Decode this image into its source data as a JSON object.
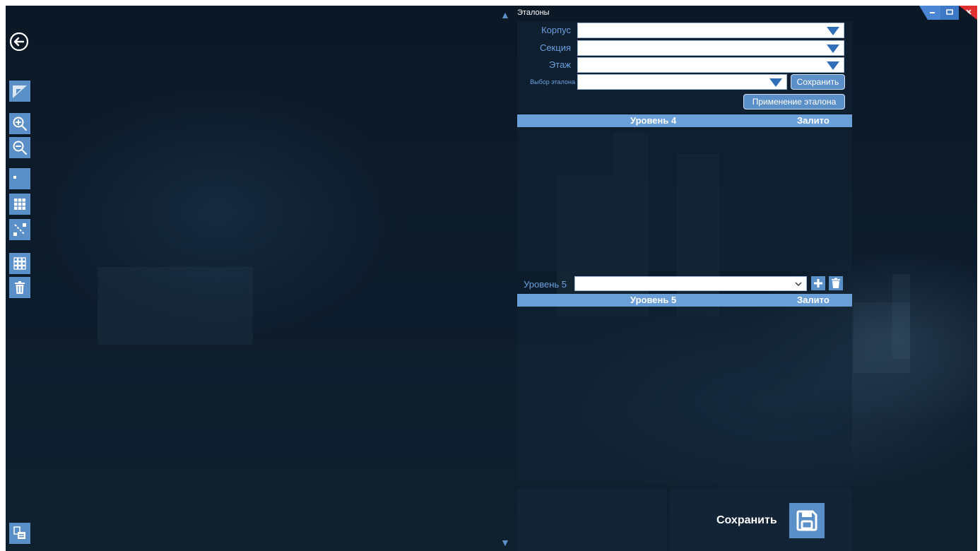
{
  "window": {
    "title": "Эталоны",
    "controls": [
      "minimize-icon",
      "restore-icon",
      "close-icon"
    ],
    "accent": "#5b8fc7",
    "close_color": "#e03030"
  },
  "toolbar": {
    "icons": [
      "back-icon",
      "draw-triangle-icon",
      "zoom-in-icon",
      "zoom-out-icon",
      "single-cell-icon",
      "grid-icon",
      "diagonal-icon",
      "empty-grid-icon",
      "trash-icon",
      "export-icon"
    ]
  },
  "form": {
    "korpus_label": "Корпус",
    "sekciya_label": "Секция",
    "etazh_label": "Этаж",
    "etalon_label": "Выбор эталона",
    "korpus_value": "",
    "sekciya_value": "",
    "etazh_value": "",
    "etalon_value": "",
    "save_label": "Сохранить",
    "apply_label": "Применение эталона"
  },
  "level4": {
    "header_col1": "Уровень 4",
    "header_col2": "Залито",
    "rows": []
  },
  "level5": {
    "selector_label": "Уровень 5",
    "selector_value": "",
    "header_col1": "Уровень 5",
    "header_col2": "Залито",
    "rows": []
  },
  "footer": {
    "save_label": "Сохранить"
  }
}
